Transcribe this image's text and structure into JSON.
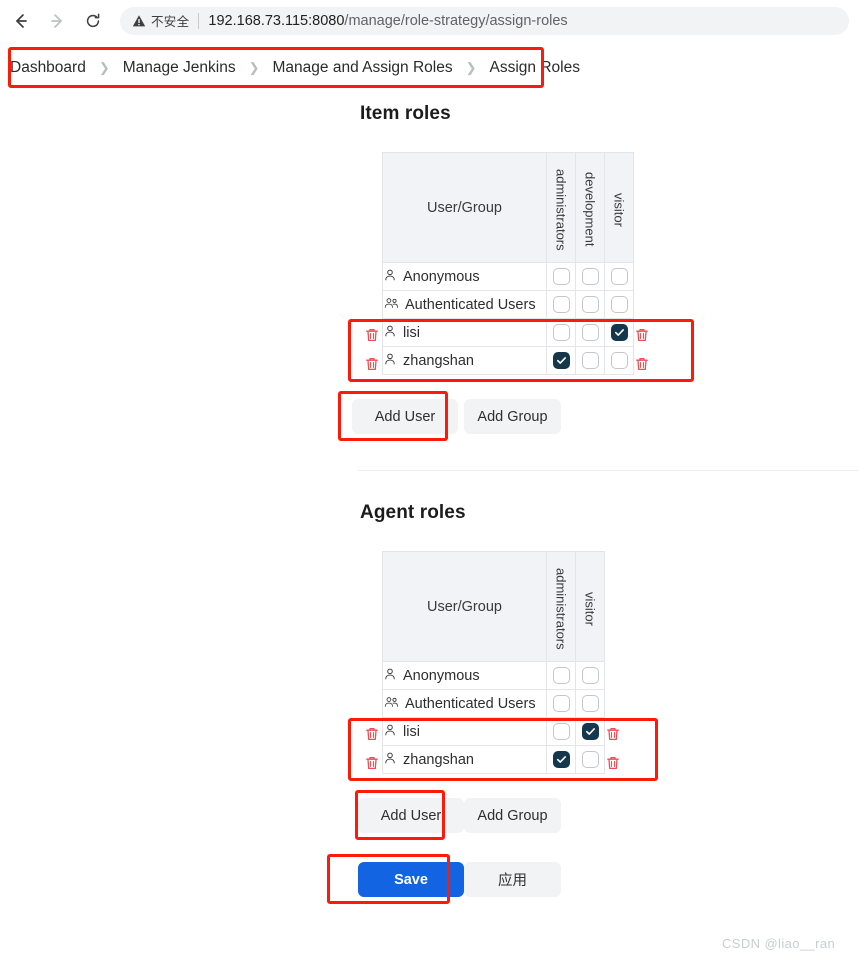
{
  "browser": {
    "back_icon": "arrow-left-icon",
    "forward_icon": "arrow-right-icon",
    "reload_icon": "reload-icon",
    "security_icon": "warning-triangle-icon",
    "security_label": "不安全",
    "url_host": "192.168.73.115:8080",
    "url_path": "/manage/role-strategy/assign-roles"
  },
  "breadcrumb": {
    "items": [
      {
        "label": "Dashboard"
      },
      {
        "label": "Manage Jenkins"
      },
      {
        "label": "Manage and Assign Roles"
      },
      {
        "label": "Assign Roles"
      }
    ],
    "separator": "❯"
  },
  "item_roles": {
    "title": "Item roles",
    "user_group_header": "User/Group",
    "role_columns": [
      "administrators",
      "development",
      "visitor"
    ],
    "rows": [
      {
        "name": "Anonymous",
        "icon": "user-icon",
        "deletable": false,
        "checks": [
          false,
          false,
          false
        ]
      },
      {
        "name": "Authenticated Users",
        "icon": "users-group-icon",
        "deletable": false,
        "checks": [
          false,
          false,
          false
        ]
      },
      {
        "name": "lisi",
        "icon": "user-icon",
        "deletable": true,
        "checks": [
          false,
          false,
          true
        ]
      },
      {
        "name": "zhangshan",
        "icon": "user-icon",
        "deletable": true,
        "checks": [
          true,
          false,
          false
        ]
      }
    ],
    "add_user_label": "Add User",
    "add_group_label": "Add Group"
  },
  "agent_roles": {
    "title": "Agent roles",
    "user_group_header": "User/Group",
    "role_columns": [
      "administrators",
      "visitor"
    ],
    "rows": [
      {
        "name": "Anonymous",
        "icon": "user-icon",
        "deletable": false,
        "checks": [
          false,
          false
        ]
      },
      {
        "name": "Authenticated Users",
        "icon": "users-group-icon",
        "deletable": false,
        "checks": [
          false,
          false
        ]
      },
      {
        "name": "lisi",
        "icon": "user-icon",
        "deletable": true,
        "checks": [
          false,
          true
        ]
      },
      {
        "name": "zhangshan",
        "icon": "user-icon",
        "deletable": true,
        "checks": [
          true,
          false
        ]
      }
    ],
    "add_user_label": "Add User",
    "add_group_label": "Add Group"
  },
  "footer": {
    "save_label": "Save",
    "apply_label": "应用"
  },
  "watermark": "CSDN @liao__ran",
  "colors": {
    "annotation": "#fc1b09",
    "checkbox_checked": "#15374c",
    "primary_button": "#1264e3",
    "trash": "#ef4d54"
  }
}
